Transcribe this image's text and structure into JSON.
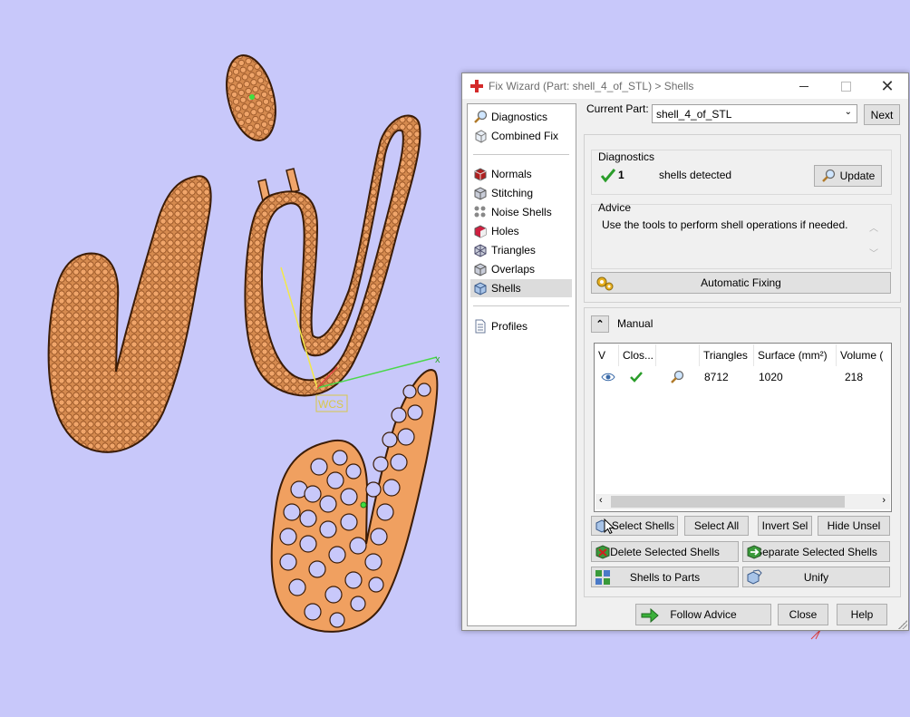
{
  "viewport": {
    "wcs_label": "WCS",
    "axis_x_label": "x"
  },
  "dialog": {
    "title": "Fix Wizard (Part: shell_4_of_STL) > Shells",
    "nav": {
      "diagnostics": "Diagnostics",
      "combined_fix": "Combined Fix",
      "normals": "Normals",
      "stitching": "Stitching",
      "noise_shells": "Noise Shells",
      "holes": "Holes",
      "triangles": "Triangles",
      "overlaps": "Overlaps",
      "shells": "Shells",
      "profiles": "Profiles"
    },
    "current_part_label": "Current Part:",
    "current_part_value": "shell_4_of_STL",
    "next_label": "Next",
    "diagnostics": {
      "title": "Diagnostics",
      "count": "1",
      "status_text": "shells detected",
      "update_label": "Update"
    },
    "advice": {
      "title": "Advice",
      "text": "Use the tools to perform shell operations if needed."
    },
    "automatic_fixing_label": "Automatic Fixing",
    "manual": {
      "title": "Manual",
      "columns": [
        "V",
        "Clos...",
        "",
        "Triangles",
        "Surface (mm²)",
        "Volume ("
      ],
      "rows": [
        {
          "triangles": "8712",
          "surface": "1020",
          "volume": "218"
        }
      ]
    },
    "buttons": {
      "select_shells": "Select Shells",
      "select_all": "Select All",
      "invert_sel": "Invert Sel",
      "hide_unsel": "Hide Unsel",
      "delete_selected_shells": "Delete Selected Shells",
      "separate_selected_shells": "Separate Selected Shells",
      "shells_to_parts": "Shells to Parts",
      "unify": "Unify",
      "follow_advice": "Follow Advice",
      "close": "Close",
      "help": "Help"
    }
  },
  "colors": {
    "background": "#c8c8fa",
    "part_orange": "#e8965a",
    "check_green": "#2a9d2a"
  }
}
